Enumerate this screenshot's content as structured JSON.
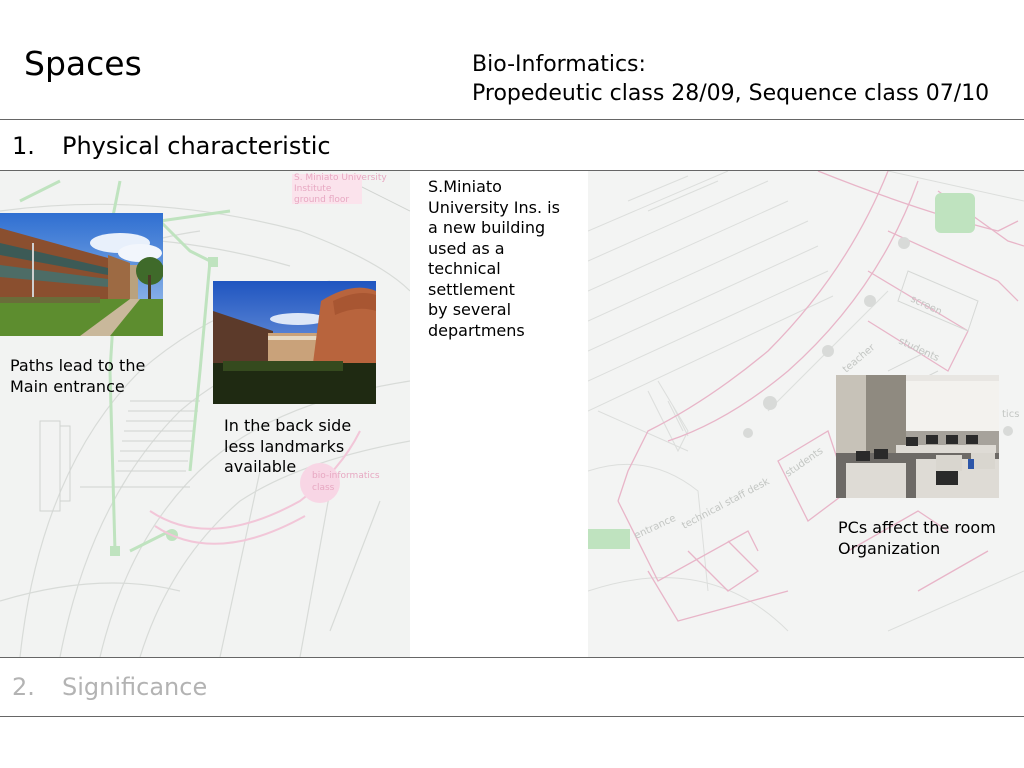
{
  "header": {
    "title": "Spaces",
    "course_line1": "Bio-Informatics:",
    "course_line2": "Propedeutic class 28/09, Sequence class 07/10"
  },
  "sections": [
    {
      "number": "1.",
      "label": "Physical characteristic"
    },
    {
      "number": "2.",
      "label": "Significance"
    }
  ],
  "left_plan": {
    "label_institute": [
      "S. Miniato University",
      "Institute",
      "ground floor"
    ],
    "label_class": [
      "bio-informatics",
      "class"
    ]
  },
  "right_plan": {
    "labels": [
      "screen",
      "students",
      "teacher",
      "students",
      "entrance",
      "technical staff desk",
      "tics"
    ]
  },
  "captions": {
    "main_entrance": [
      "Paths lead to the",
      "Main entrance"
    ],
    "back_side": [
      "In the back side",
      "less landmarks",
      "available"
    ],
    "description": [
      "S.Miniato",
      "University Ins. is",
      "a new building",
      "used as a",
      "technical",
      "settlement",
      "by several",
      "departmens"
    ],
    "pcs": [
      "PCs affect the room",
      "Organization"
    ]
  }
}
